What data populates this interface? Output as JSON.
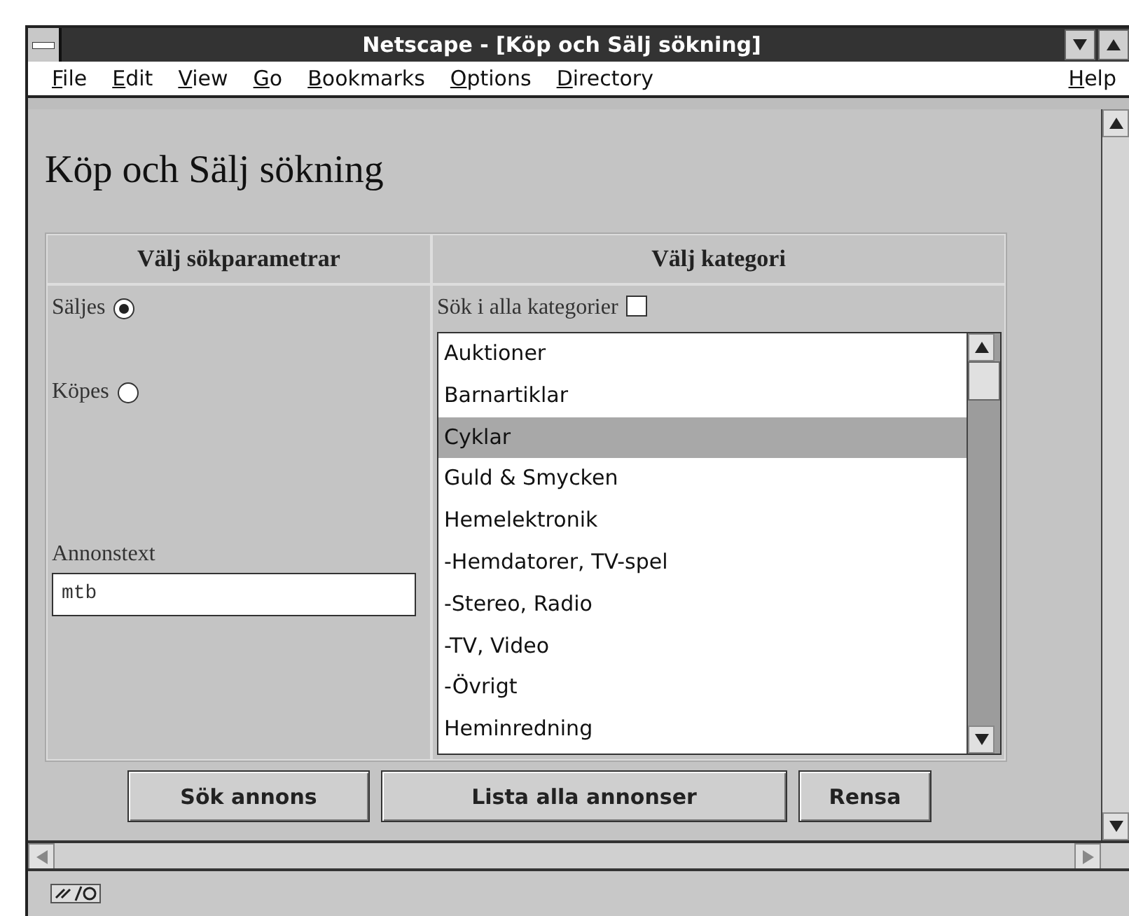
{
  "window": {
    "title": "Netscape - [Köp och Sälj sökning]"
  },
  "menu": [
    {
      "label": "File"
    },
    {
      "label": "Edit"
    },
    {
      "label": "View"
    },
    {
      "label": "Go"
    },
    {
      "label": "Bookmarks"
    },
    {
      "label": "Options"
    },
    {
      "label": "Directory"
    },
    {
      "label": "Help",
      "right": true
    }
  ],
  "page": {
    "heading": "Köp och Sälj sökning",
    "columns": [
      "Välj sökparametrar",
      "Välj kategori"
    ],
    "radios": [
      {
        "label": "Säljes",
        "selected": true
      },
      {
        "label": "Köpes",
        "selected": false
      }
    ],
    "all_categories": {
      "label": "Sök i alla kategorier",
      "checked": false
    },
    "text_field": {
      "label": "Annonstext",
      "value": "mtb"
    },
    "categories": [
      {
        "label": "Auktioner",
        "selected": false
      },
      {
        "label": "Barnartiklar",
        "selected": false
      },
      {
        "label": "Cyklar",
        "selected": true
      },
      {
        "label": "Guld & Smycken",
        "selected": false
      },
      {
        "label": "Hemelektronik",
        "selected": false
      },
      {
        "label": "-Hemdatorer, TV-spel",
        "selected": false
      },
      {
        "label": "-Stereo, Radio",
        "selected": false
      },
      {
        "label": "-TV, Video",
        "selected": false
      },
      {
        "label": "-Övrigt",
        "selected": false
      },
      {
        "label": "Heminredning",
        "selected": false
      }
    ],
    "buttons": [
      "Sök annons",
      "Lista alla annonser",
      "Rensa"
    ]
  }
}
